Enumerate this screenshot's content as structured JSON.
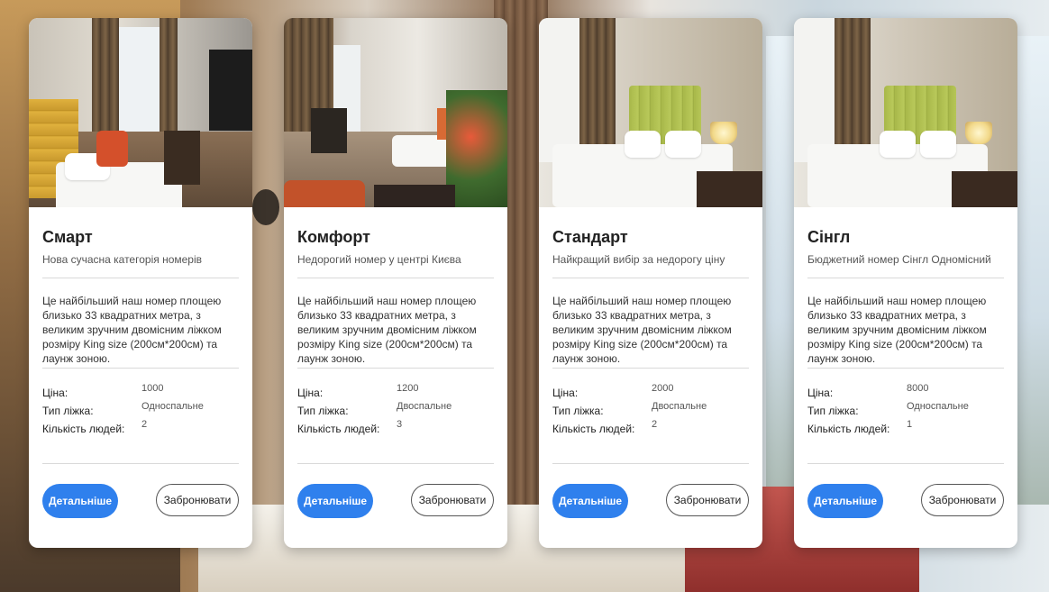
{
  "labels": {
    "price": "Ціна:",
    "bed_type": "Тип ліжка:",
    "people": "Кількість людей:",
    "details_button": "Детальніше",
    "book_button": "Забронювати"
  },
  "rooms": [
    {
      "title": "Смарт",
      "subtitle": "Нова сучасна категорія номерів",
      "description": "Це найбільший наш номер площею близько 33 квадратних метра, з великим зручним двомісним ліжком розміру King size (200см*200см) та лаунж зоною.",
      "price": "1000",
      "bed_type": "Односпальне",
      "people": "2"
    },
    {
      "title": "Комфорт",
      "subtitle": "Недорогий номер у центрі Києва",
      "description": "Це найбільший наш номер площею близько 33 квадратних метра, з великим зручним двомісним ліжком розміру King size (200см*200см) та лаунж зоною.",
      "price": "1200",
      "bed_type": "Двоспальне",
      "people": "3"
    },
    {
      "title": "Стандарт",
      "subtitle": "Найкращий вибір за недорогу ціну",
      "description": "Це найбільший наш номер площею близько 33 квадратних метра, з великим зручним двомісним ліжком розміру King size (200см*200см) та лаунж зоною.",
      "price": "2000",
      "bed_type": "Двоспальне",
      "people": "2"
    },
    {
      "title": "Сінгл",
      "subtitle": "Бюджетний номер Сінгл Одномісний",
      "description": "Це найбільший наш номер площею близько 33 квадратних метра, з великим зручним двомісним ліжком розміру King size (200см*200см) та лаунж зоною.",
      "price": "8000",
      "bed_type": "Односпальне",
      "people": "1"
    }
  ],
  "colors": {
    "primary_button": "#2f80ed",
    "card_background": "#ffffff"
  }
}
